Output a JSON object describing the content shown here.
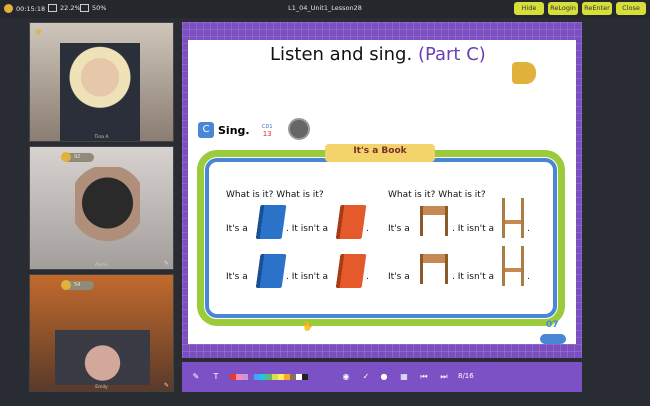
{
  "topbar": {
    "timer": "00:15:18",
    "cpu": "22.2%",
    "mem": "50%",
    "lesson_name": "L1_04_Unit1_Lesson28",
    "buttons": [
      "Hide",
      "ReLogin",
      "ReEnter",
      "Close"
    ]
  },
  "participants": [
    {
      "name": "Tina A"
    },
    {
      "name": "Aarav"
    },
    {
      "name": "Emily"
    }
  ],
  "badges": [
    "92",
    "54"
  ],
  "slide": {
    "title": "Listen and sing.",
    "part": "(Part C)",
    "section_letter": "C",
    "section_label": "Sing.",
    "track_num": "13",
    "track_label": "CD1",
    "banner": "It's a Book",
    "left_q": "What is it? What is it?",
    "right_q": "What is it? What is it?",
    "its_a": "It's a",
    "isnt_a": ". It isn't a",
    "period": ".",
    "page_num": "07"
  },
  "toolbar": {
    "page": "8/16"
  },
  "colors": {
    "accent": "#7c4fc1",
    "button": "#d6de3a",
    "title_part": "#6a3fb6"
  }
}
